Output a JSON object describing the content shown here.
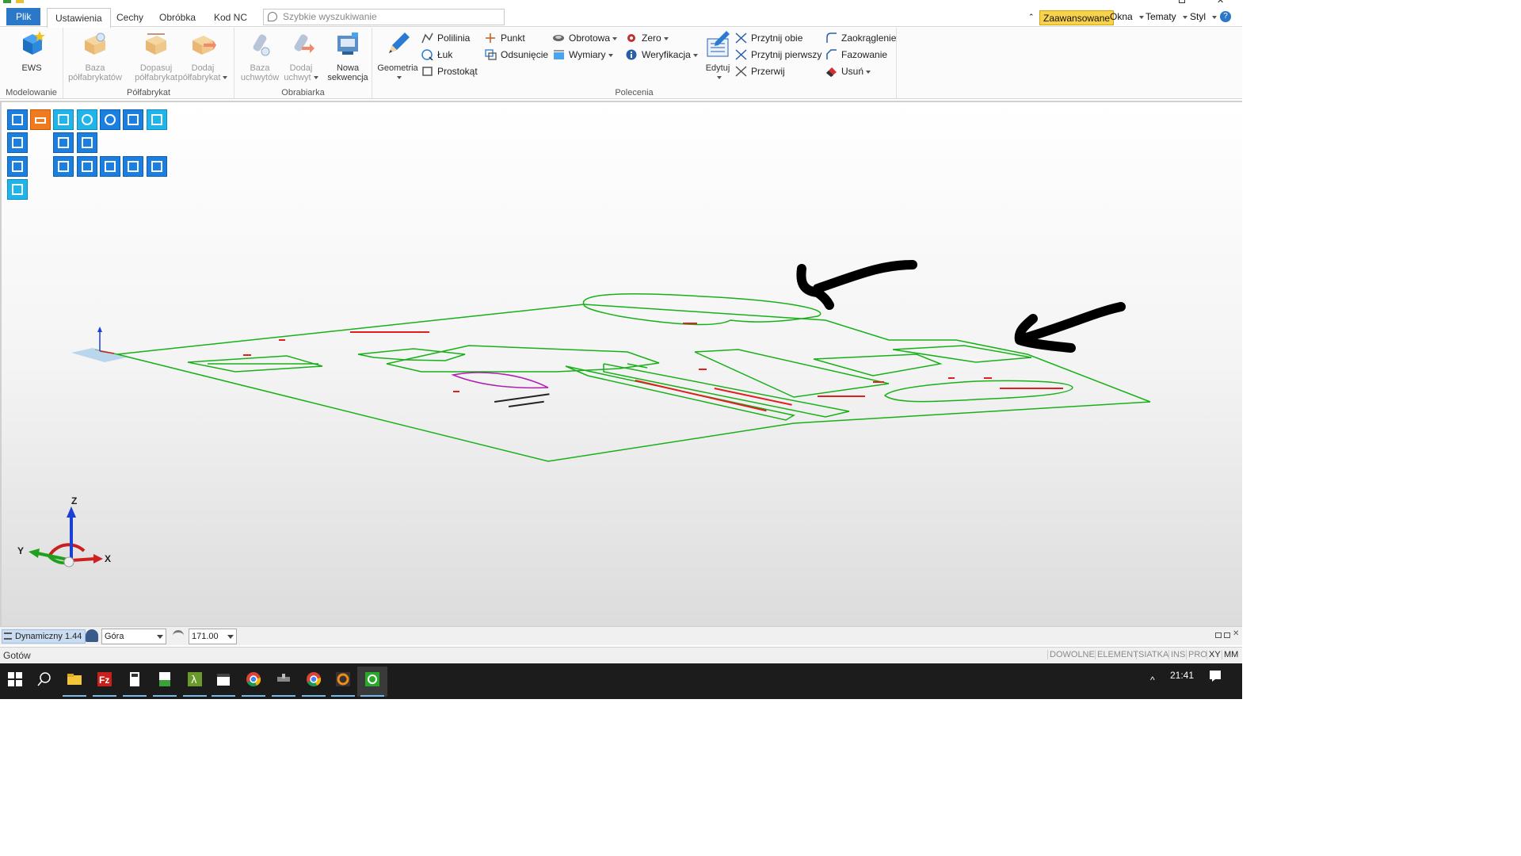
{
  "tabs": {
    "file": "Plik",
    "items": [
      "Ustawienia",
      "Cechy",
      "Obróbka",
      "Kod NC"
    ],
    "active": "Ustawienia"
  },
  "search": {
    "placeholder": "Szybkie wyszukiwanie"
  },
  "topright": {
    "advanced": "Zaawansowane",
    "windows": "Okna",
    "themes": "Tematy",
    "style": "Styl"
  },
  "ribbon": {
    "groups": {
      "modeling": "Modelowanie",
      "stock": "Półfabrykat",
      "machine": "Obrabiarka",
      "commands": "Polecenia"
    },
    "ews": "EWS",
    "stock_base": [
      "Baza",
      "półfabrykatów"
    ],
    "fit_stock": [
      "Dopasuj",
      "półfabrykat"
    ],
    "add_stock": [
      "Dodaj",
      "półfabrykat"
    ],
    "fixture_base": [
      "Baza",
      "uchwytów"
    ],
    "add_fixture": [
      "Dodaj",
      "uchwyt"
    ],
    "new_sequence": [
      "Nowa",
      "sekwencja"
    ],
    "geometry": "Geometria",
    "polyline": "Polilinia",
    "arc": "Łuk",
    "rectangle": "Prostokąt",
    "point": "Punkt",
    "offset": "Odsunięcie",
    "rotary": "Obrotowa",
    "dimensions": "Wymiary",
    "zero": "Zero",
    "verification": "Weryfikacja",
    "edit": "Edytuj",
    "trim_both": "Przytnij obie",
    "trim_first": "Przytnij pierwszy",
    "break": "Przerwij",
    "fillet": "Zaokrąglenie",
    "chamfer": "Fazowanie",
    "delete": "Usuń"
  },
  "viewport": {
    "axis_labels": {
      "x": "X",
      "y": "Y",
      "z": "Z"
    },
    "geometry_color": "#18b018",
    "annotation_color": "#e02020"
  },
  "viewbar": {
    "mode": "Dynamiczny 1.44",
    "view_select": "Góra",
    "zoom_value": "171.00"
  },
  "statusbar": {
    "text": "Gotów",
    "flags": [
      "DOWOLNE",
      "ELEMENT",
      "SIATKA",
      "INS",
      "PRO",
      "XY",
      "MM"
    ]
  },
  "taskbar": {
    "time": "21:41"
  }
}
